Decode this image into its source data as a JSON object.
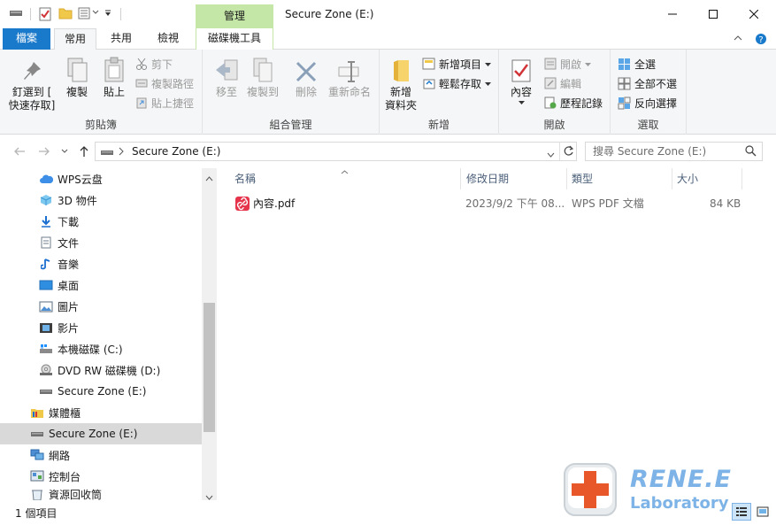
{
  "window": {
    "title": "Secure Zone (E:)",
    "context_tab_header": "管理",
    "minimize_glyph": "—",
    "maximize_glyph": "☐",
    "close_glyph": "✕"
  },
  "quick_access": {
    "icons": [
      "drive-icon",
      "checkmark-doc-icon",
      "folder-icon",
      "properties-icon",
      "customize-dropdown-icon"
    ]
  },
  "tabs": {
    "file": "檔案",
    "home": "常用",
    "share": "共用",
    "view": "檢視",
    "drive_tools": "磁碟機工具"
  },
  "ribbon": {
    "clipboard": {
      "label": "剪貼簿",
      "pin": "釘選到 [\n快速存取]",
      "copy": "複製",
      "paste": "貼上",
      "cut": "剪下",
      "copy_path": "複製路徑",
      "paste_shortcut": "貼上捷徑"
    },
    "organize": {
      "label": "組合管理",
      "move_to": "移至",
      "copy_to": "複製到",
      "delete": "刪除",
      "rename": "重新命名"
    },
    "new": {
      "label": "新增",
      "new_folder": "新增\n資料夾",
      "new_item": "新增項目",
      "easy_access": "輕鬆存取"
    },
    "open": {
      "label": "開啟",
      "properties": "內容",
      "open": "開啟",
      "edit": "編輯",
      "history": "歷程記錄"
    },
    "select": {
      "label": "選取",
      "select_all": "全選",
      "select_none": "全部不選",
      "invert": "反向選擇"
    }
  },
  "address": {
    "path": "Secure Zone (E:)",
    "search_placeholder": "搜尋 Secure Zone (E:)"
  },
  "nav": {
    "items": [
      {
        "label": "WPS云盘",
        "icon": "cloud-icon"
      },
      {
        "label": "3D 物件",
        "icon": "cube-3d-icon"
      },
      {
        "label": "下載",
        "icon": "download-icon"
      },
      {
        "label": "文件",
        "icon": "document-icon"
      },
      {
        "label": "音樂",
        "icon": "music-icon"
      },
      {
        "label": "桌面",
        "icon": "desktop-icon"
      },
      {
        "label": "圖片",
        "icon": "pictures-icon"
      },
      {
        "label": "影片",
        "icon": "video-icon"
      },
      {
        "label": "本機磁碟 (C:)",
        "icon": "windows-drive-icon"
      },
      {
        "label": "DVD RW 磁碟機 (D:)",
        "icon": "dvd-drive-icon"
      },
      {
        "label": "Secure Zone (E:)",
        "icon": "drive-icon"
      },
      {
        "label": "媒體櫃",
        "icon": "libraries-icon"
      },
      {
        "label": "Secure Zone (E:)",
        "icon": "drive-icon"
      },
      {
        "label": "網路",
        "icon": "network-icon"
      },
      {
        "label": "控制台",
        "icon": "control-panel-icon"
      },
      {
        "label": "資源回收筒",
        "icon": "recycle-bin-icon"
      }
    ]
  },
  "columns": {
    "name": "名稱",
    "modified": "修改日期",
    "type": "類型",
    "size": "大小"
  },
  "files": [
    {
      "name": "內容.pdf",
      "modified": "2023/9/2 下午 08...",
      "type": "WPS PDF 文檔",
      "size": "84 KB"
    }
  ],
  "status": {
    "count": "1 個項目"
  },
  "watermark": {
    "brand": "RENE.E",
    "sub": "Laboratory"
  },
  "colors": {
    "accent": "#1979ca",
    "context_tab": "#c4e7a7",
    "ribbon_bg": "#f5f6f7",
    "selection": "#d9d9d9"
  }
}
